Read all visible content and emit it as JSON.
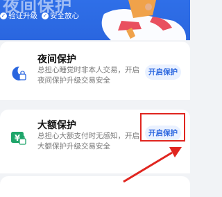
{
  "header": {
    "title": "夜间保护",
    "features": [
      "验证升级",
      "安全放心"
    ]
  },
  "cards": [
    {
      "title": "夜间保护",
      "description": "总担心睡觉时非本人交易，开启夜间保护升级交易安全",
      "button": "开启保护",
      "icon": "moon-lock-icon"
    },
    {
      "title": "大额保护",
      "description": "总担心大额支付时无感知，开启大额保护升级交易安全",
      "button": "开启保护",
      "icon": "yen-lock-icon"
    }
  ],
  "annotation": {
    "highlight_color": "#e0251f",
    "arrow_color": "#e0251f"
  },
  "colors": {
    "accent": "#2a66df",
    "button_bg": "#eaf1ff"
  }
}
